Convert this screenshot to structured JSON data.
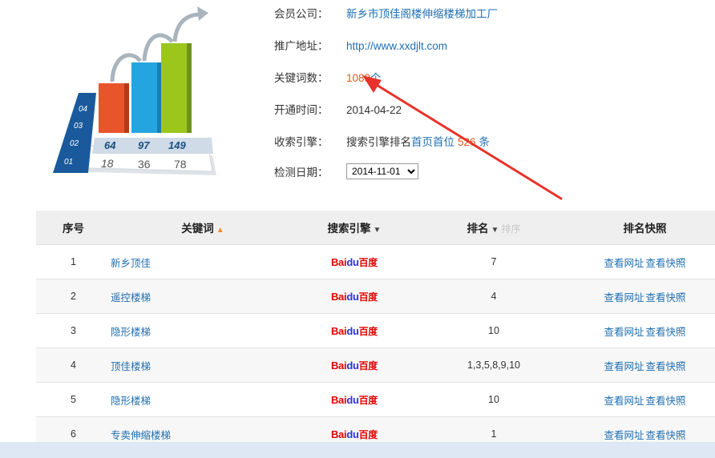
{
  "info": {
    "member_label": "会员公司：",
    "member_value": "新乡市顶佳阁楼伸缩楼梯加工厂",
    "url_label": "推广地址：",
    "url_value": "http://www.xxdjlt.com",
    "keywords_label": "关键词数：",
    "keywords_count": "1089",
    "keywords_unit": "个",
    "open_label": "开通时间：",
    "open_value": "2014-04-22",
    "index_label": "收索引擎：",
    "index_prefix": "搜索引擎排名",
    "index_link": "首页首位",
    "index_count": "526",
    "index_unit": "条",
    "check_label": "检测日期：",
    "check_date": "2014-11-01"
  },
  "hero": {
    "bars": [
      "64",
      "97",
      "149"
    ],
    "bottom": [
      "18",
      "36",
      "78"
    ],
    "rows": [
      "04",
      "03",
      "02",
      "01"
    ]
  },
  "table": {
    "headers": {
      "no": "序号",
      "keyword": "关键词",
      "engine": "搜索引擎",
      "rank": "排名",
      "rank_faded": "排序",
      "snapshot": "排名快照"
    },
    "rows": [
      {
        "no": "1",
        "keyword": "新乡顶佳",
        "engine": "Baidu",
        "rank": "7",
        "link1": "查看网址",
        "link2": "查看快照"
      },
      {
        "no": "2",
        "keyword": "遥控楼梯",
        "engine": "Baidu",
        "rank": "4",
        "link1": "查看网址",
        "link2": "查看快照"
      },
      {
        "no": "3",
        "keyword": "隐形楼梯",
        "engine": "Baidu",
        "rank": "10",
        "link1": "查看网址",
        "link2": "查看快照"
      },
      {
        "no": "4",
        "keyword": "顶佳楼梯",
        "engine": "Baidu",
        "rank": "1,3,5,8,9,10",
        "link1": "查看网址",
        "link2": "查看快照"
      },
      {
        "no": "5",
        "keyword": "隐形楼梯",
        "engine": "Baidu",
        "rank": "10",
        "link1": "查看网址",
        "link2": "查看快照"
      },
      {
        "no": "6",
        "keyword": "专卖伸缩楼梯",
        "engine": "Baidu",
        "rank": "1",
        "link1": "查看网址",
        "link2": "查看快照"
      }
    ],
    "baidu_text_a": "Bai",
    "baidu_text_b": "du",
    "baidu_text_c": "百度"
  },
  "colors": {
    "link": "#1f6fb2",
    "accent_orange": "#e0591a",
    "header_bg": "#efefef",
    "arrow_red": "#e8332a"
  }
}
